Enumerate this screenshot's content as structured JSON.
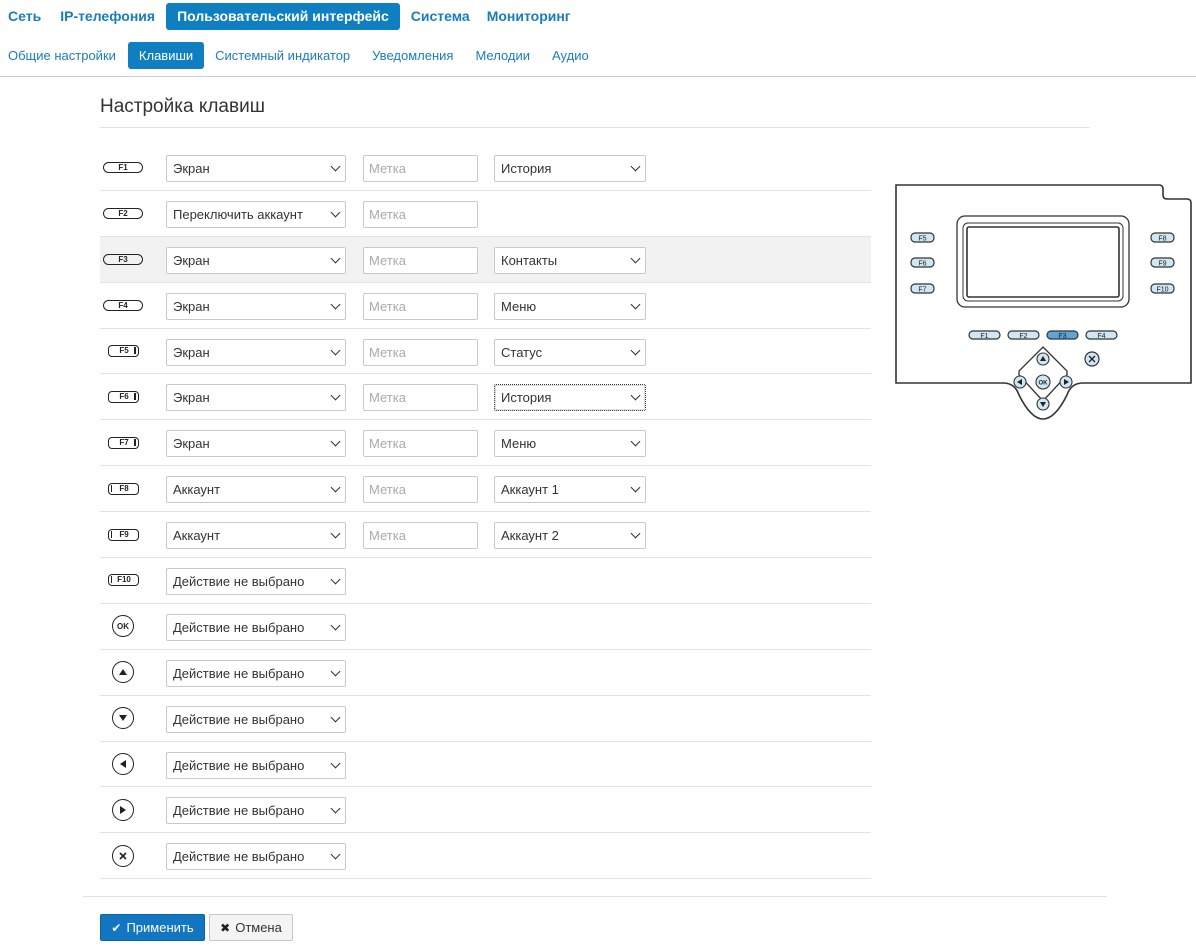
{
  "topnav": {
    "items": [
      "Сеть",
      "IP-телефония",
      "Пользовательский интерфейс",
      "Система",
      "Мониторинг"
    ],
    "active": "Пользовательский интерфейс"
  },
  "subnav": {
    "items": [
      "Общие настройки",
      "Клавиши",
      "Системный индикатор",
      "Уведомления",
      "Мелодии",
      "Аудио"
    ],
    "active": "Клавиши"
  },
  "page": {
    "title": "Настройка клавиш"
  },
  "keys": [
    {
      "key": "F1",
      "action": "Экран",
      "label_placeholder": "Метка",
      "target": "История"
    },
    {
      "key": "F2",
      "action": "Переключить аккаунт",
      "label_placeholder": "Метка"
    },
    {
      "key": "F3",
      "action": "Экран",
      "label_placeholder": "Метка",
      "target": "Контакты"
    },
    {
      "key": "F4",
      "action": "Экран",
      "label_placeholder": "Метка",
      "target": "Меню"
    },
    {
      "key": "F5",
      "action": "Экран",
      "label_placeholder": "Метка",
      "target": "Статус"
    },
    {
      "key": "F6",
      "action": "Экран",
      "label_placeholder": "Метка",
      "target": "История"
    },
    {
      "key": "F7",
      "action": "Экран",
      "label_placeholder": "Метка",
      "target": "Меню"
    },
    {
      "key": "F8",
      "action": "Аккаунт",
      "label_placeholder": "Метка",
      "target": "Аккаунт 1"
    },
    {
      "key": "F9",
      "action": "Аккаунт",
      "label_placeholder": "Метка",
      "target": "Аккаунт 2"
    },
    {
      "key": "F10",
      "action": "Действие не выбрано"
    },
    {
      "key": "OK",
      "action": "Действие не выбрано"
    },
    {
      "key": "up-arrow",
      "action": "Действие не выбрано"
    },
    {
      "key": "down-arrow",
      "action": "Действие не выбрано"
    },
    {
      "key": "left-arrow",
      "action": "Действие не выбрано"
    },
    {
      "key": "right-arrow",
      "action": "Действие не выбрано"
    },
    {
      "key": "cancel-x",
      "action": "Действие не выбрано"
    }
  ],
  "device": {
    "left_keys": [
      "F5",
      "F6",
      "F7"
    ],
    "right_keys": [
      "F8",
      "F9",
      "F10"
    ],
    "bottom_keys": [
      "F1",
      "F2",
      "F3",
      "F4"
    ],
    "highlighted_key": "F3",
    "ok_label": "OK",
    "highlight_color": "#5aa6d8",
    "key_fill": "#cfe6f4"
  },
  "buttons": {
    "apply": "Применить",
    "cancel": "Отмена"
  },
  "colors": {
    "accent": "#0f7fc2",
    "link": "#1a7dbb"
  }
}
